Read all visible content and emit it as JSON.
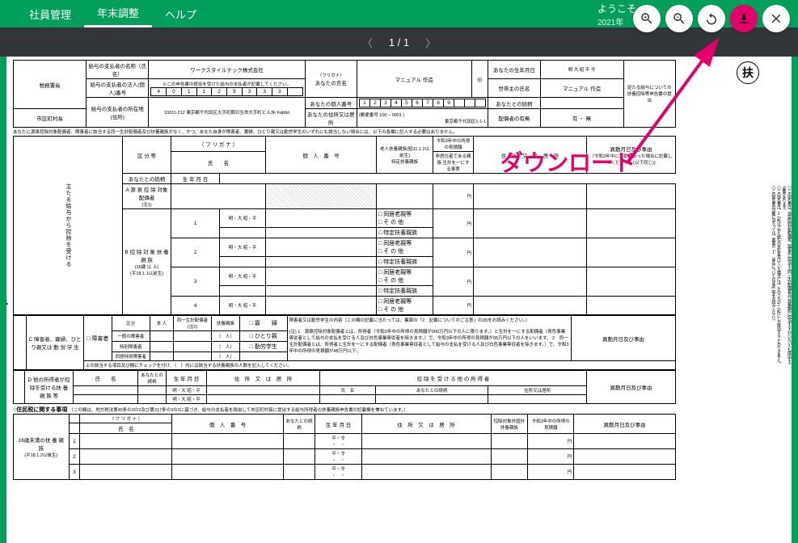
{
  "nav": {
    "items": [
      "社員管理",
      "年末調整",
      "ヘルプ"
    ],
    "active_idx": 1,
    "welcome": "ようこそ",
    "welcome_sub": "2021年"
  },
  "viewer": {
    "page_indicator": "1 / 1",
    "download_callout": "ダウンロード"
  },
  "form": {
    "stamp": "扶",
    "header": {
      "tax_office_label": "税務署長",
      "city_label": "市区町村長",
      "payer_name_label": "給与の支払者の名称（氏名）",
      "payer_name": "ワークスタイルテック株式会社",
      "payer_num_label": "給与の支払者の法人(個人)番号",
      "payer_num_note": "※この申告書の提出を受けた給与の支払者が記載してください。",
      "payer_num": [
        "4",
        "0",
        "1",
        "1",
        "2",
        "9",
        "3",
        "3",
        "3",
        ""
      ],
      "payer_addr_label": "給与の支払者の所在地(住所)",
      "payer_addr": "10011-212 東京都千代田区大手町朝日生命大手町ビル3F Fabbit",
      "furigana_label": "（フリガナ）",
      "your_name_label": "あなたの氏名",
      "your_name": "マニュアル 作造",
      "your_num_label": "あなたの個人番号",
      "your_num": [
        "1",
        "2",
        "3",
        "4",
        "5",
        "6",
        "7",
        "8",
        "9",
        "",
        "",
        ""
      ],
      "your_addr_label": "あなたの住所又は居所",
      "postal": "(郵便番号 100 − 0001 )",
      "your_addr": "東京都千代田区1-1-1",
      "birth_label": "あなたの生年月日",
      "birth_prefix": "明 大 昭 平 令",
      "head_name_label": "世帯主の氏名",
      "head_name": "マニュアル 作造",
      "relation_label": "あなたとの続柄",
      "spouse_label": "配偶者の有無",
      "spouse_opts": "有 ・ 無",
      "top_right_note": "従たる給与についての扶養控除等申告書の提出"
    },
    "notice": "あなたに源泉控除対象配偶者、障害者に該当する同一生計配偶者及び扶養親族がなく、かつ、あなた自身が障害者、寡婦、ひとり親又は勤労学生のいずれにも該当しない場合には、以下の各欄に記入する必要はありません。",
    "columns": {
      "kubun": "区 分 等",
      "furigana": "（ フ リ ガ ナ ）",
      "name": "氏　　名",
      "relation": "あなたとの続柄",
      "birth": "生 年 月 日",
      "kojin": "個　人　番　号",
      "special": "特定扶養親族",
      "rouzin": "老人扶養親族(昭31.1.2以前生)",
      "address": "住　所　又　は　居　所",
      "income": "令和3年中の所得の見積額",
      "hijikyo": "非居住者である親族",
      "jiji": "生計を一にする事実",
      "idou": "異動月日及び事由",
      "idou_note": "（令和3年中に異動があった場合に記載してください。(以下同じ))"
    },
    "sections": {
      "left_spine": "主たる給与から控除を受ける",
      "a_label": "A",
      "a_title": "源 泉 控 除 対象配偶者",
      "a_note": "(注1)",
      "b_label": "B",
      "b_title": "控 除 対 象 扶 養 親 族",
      "b_note": "(16歳 以 上)",
      "b_note2": "(平18.1.1以前生)",
      "row_eras": "明・大 昭・平",
      "doukyo": "同居老親等",
      "sonota": "そ の 他",
      "tokutei": "特定扶養親族",
      "yen": "円",
      "c_label": "C",
      "c_title": "障害者、寡婦、ひとり親又は 勤 労 学 生",
      "c_cols": {
        "shogaisha": "障害者",
        "kubun": "区分",
        "honnin": "本 人",
        "douitu": "同一生計配偶者(注2)",
        "fuyo": "扶養親族",
        "ippan": "一般の障害者",
        "tokubetsu": "特別障害者",
        "doukyo_tokubetsu": "同居特別障害者",
        "kafu": "寡　　婦",
        "hitorioya": "ひとり親",
        "kinrou": "勤労学生",
        "ninzu": "（　人）"
      },
      "c_right_title": "障害者又は勤労学生の内容（この欄の記載に当たっては、裏面の「2　記載についてのご注意」の(8)をお読みください。）",
      "c_notes": "(注) 1　源泉控除対象配偶者とは、所得者（令和3年中の所得の見積額が900万円以下の人に限ります。）と生計を一にする配偶者（青色事業専従者として給与の支払を受ける人及び白色事業専従者を除きます。）で、令和3年中の所得の見積額が95万円以下の人をいいます。 2　同一生計配偶者とは、所得者と生計を一にする配偶者（青色事業専従者として給与の支払を受ける人及び白色事業専従者を除きます。）で、令和3年中の所得の見積額が48万円以下、",
      "c_bottom_note": "上の該当する項目及び欄にチェックを付け、（　）内には該当する扶養親族の人数を記入してください。",
      "d_label": "D",
      "d_title": "他の所得者が控除を受ける扶 養 親 族 等",
      "d_cols": {
        "name": "氏　　名",
        "relation": "あなたとの続柄",
        "birth": "生 年 月 日",
        "addr": "住　所　又　は　居　所",
        "other_title": "控 除 を 受 け る 他 の 所 得 者",
        "other_name": "氏　名",
        "other_rel": "あなたとの続柄",
        "other_addr": "住所又は居所",
        "idou": "異動月日及び事由"
      }
    },
    "juminzei": {
      "title": "○住民税に関する事項",
      "note": "（この欄は、地方税法第45条の3の2及び第317条の3の2に基づき、給与の支払者を経由して市区町村長に提出する給与所得者の扶養親族申告書の記載欄を兼ねています。）",
      "section_title": "16歳未満の扶 養 親 族",
      "section_note": "(平18.1.2以後生)",
      "cols": {
        "furigana": "（ フ リ ガ ナ ）",
        "name": "氏　名",
        "kojin": "個　人　番　号",
        "rel": "あなたとの続柄",
        "birth": "生 年 月 日",
        "addr": "住　所　又　は　居　所",
        "nonres": "控除対象外国外扶養親族",
        "income": "令和3年中の所得の見積額",
        "idou": "異動月日及び事由"
      },
      "row_nums": [
        "1",
        "2",
        "3"
      ]
    },
    "side_notes": [
      "◎この申告書は、あなたの給与について扶養控除、障害者控除などの控除を受けるために提出するものです。",
      "◎この申告書は、源泉控除対象配偶者、障害者に該当する同一生計配偶者及び扶養親族に該当する人がいない人も提出する",
      "必要があります。",
      "◎この申告書は、2か所以上から給与の支払を受けている場合には、そのうちの1か所にしか提出することができません。",
      "◎この申告書の記載に当たっては、裏面の「1　申告についての注意」等をお読みください。"
    ]
  }
}
